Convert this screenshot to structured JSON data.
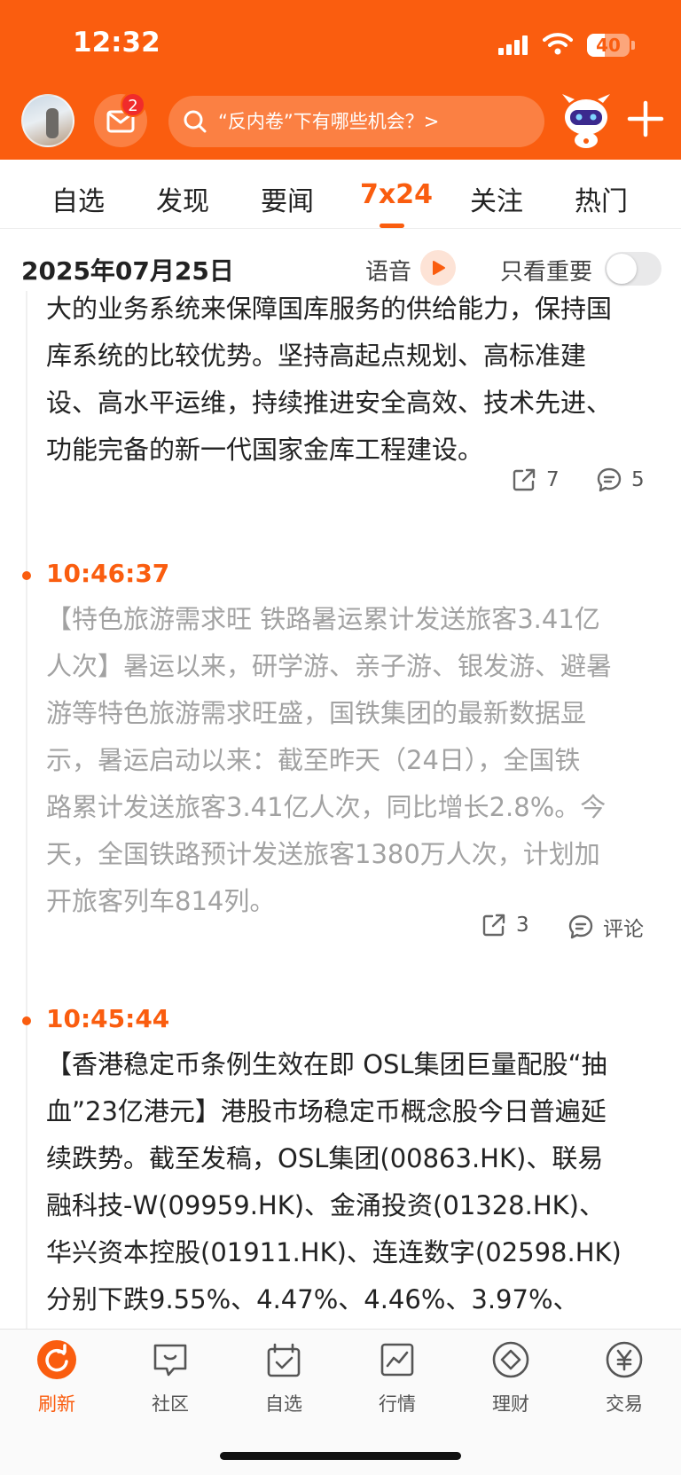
{
  "status_bar": {
    "time": "12:32",
    "battery": "40"
  },
  "header": {
    "mail_badge": "2",
    "search_placeholder": "“反内卷”下有哪些机会？>"
  },
  "tabs": [
    {
      "label": "自选"
    },
    {
      "label": "发现"
    },
    {
      "label": "要闻"
    },
    {
      "label": "7x24",
      "active": true
    },
    {
      "label": "关注"
    },
    {
      "label": "热门"
    }
  ],
  "date_bar": {
    "date": "2025年07月25日",
    "voice_label": "语音",
    "important_only_label": "只看重要"
  },
  "feed": {
    "items": [
      {
        "time": "",
        "lines": [
          "大的业务系统来保障国库服务的供给能力，保持国",
          "库系统的比较优势。坚持高起点规划、高标准建",
          "设、高水平运维，持续推进安全高效、技术先进、",
          "功能完备的新一代国家金库工程建设。"
        ],
        "share_count": "7",
        "comment_count": "5"
      },
      {
        "time": "10:46:37",
        "lines": [
          "【特色旅游需求旺 铁路暑运累计发送旅客3.41亿",
          "人次】暑运以来，研学游、亲子游、银发游、避暑",
          "游等特色旅游需求旺盛，国铁集团的最新数据显",
          "示，暑运启动以来：截至昨天（24日），全国铁",
          "路累计发送旅客3.41亿人次，同比增长2.8%。今",
          "天，全国铁路预计发送旅客1380万人次，计划加",
          "开旅客列车814列。"
        ],
        "share_count": "3",
        "comment_count": "评论"
      },
      {
        "time": "10:45:44",
        "lines": [
          "【香港稳定币条例生效在即 OSL集团巨量配股“抽",
          "血”23亿港元】港股市场稳定币概念股今日普遍延",
          "续跌势。截至发稿，OSL集团(00863.HK)、联易",
          "融科技-W(09959.HK)、金涌投资(01328.HK)、",
          "华兴资本控股(01911.HK)、连连数字(02598.HK)",
          "分别下跌9.55%、4.47%、4.46%、3.97%、"
        ]
      }
    ]
  },
  "bottom_nav": [
    {
      "label": "刷新",
      "icon": "refresh-icon",
      "active": true
    },
    {
      "label": "社区",
      "icon": "community-icon"
    },
    {
      "label": "自选",
      "icon": "watchlist-icon"
    },
    {
      "label": "行情",
      "icon": "market-icon"
    },
    {
      "label": "理财",
      "icon": "wealth-icon"
    },
    {
      "label": "交易",
      "icon": "trade-icon"
    }
  ],
  "colors": {
    "brand": "#fa5d0f",
    "badge": "#f02b2b",
    "read_text": "#a2a2a2",
    "text": "#222222"
  }
}
